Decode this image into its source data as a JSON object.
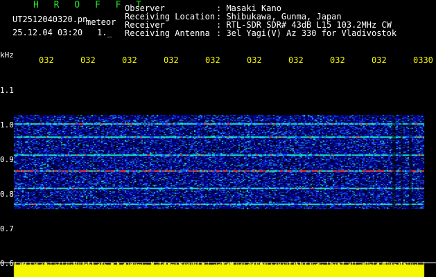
{
  "header": {
    "brand": "H R O F F T",
    "file_name": "UT2512040320.pn",
    "mode": "meteor",
    "timestamp": "25.12.04 03:20",
    "frame_index": "1._"
  },
  "station": {
    "observer_label": "Observer",
    "observer_value": ": Masaki Kano",
    "location_label": "Receiving Location",
    "location_value": ": Shibukawa, Gunma, Japan",
    "receiver_label": "Receiver",
    "receiver_value": ": RTL-SDR SDR# 43dB L15 103.2MHz CW",
    "antenna_label": "Receiving Antenna",
    "antenna_value": ": 3el Yagi(V) Az 330 for Vladivostok"
  },
  "axes": {
    "y_unit": "kHz",
    "y_ticks": [
      "1.1",
      "1.0",
      "0.9",
      "0.8",
      "0.7",
      "0.6"
    ],
    "x_ticks": [
      "032",
      "032",
      "032",
      "032",
      "032",
      "032",
      "032",
      "032",
      "032",
      "0330"
    ]
  },
  "colors": {
    "background": "#000000",
    "noise_low": "#00008a",
    "noise_mid": "#1e4fff",
    "signal": "#19e6c8",
    "strong": "#ff3a1e",
    "baseline": "#f6f600",
    "brand": "#27e827"
  },
  "spectrogram": {
    "band_top_khz": 1.03,
    "band_bottom_khz": 0.76,
    "echo_lines_khz": [
      1.005,
      0.967,
      0.915,
      0.868,
      0.818,
      0.773
    ],
    "strongest_line_khz": 0.868
  }
}
